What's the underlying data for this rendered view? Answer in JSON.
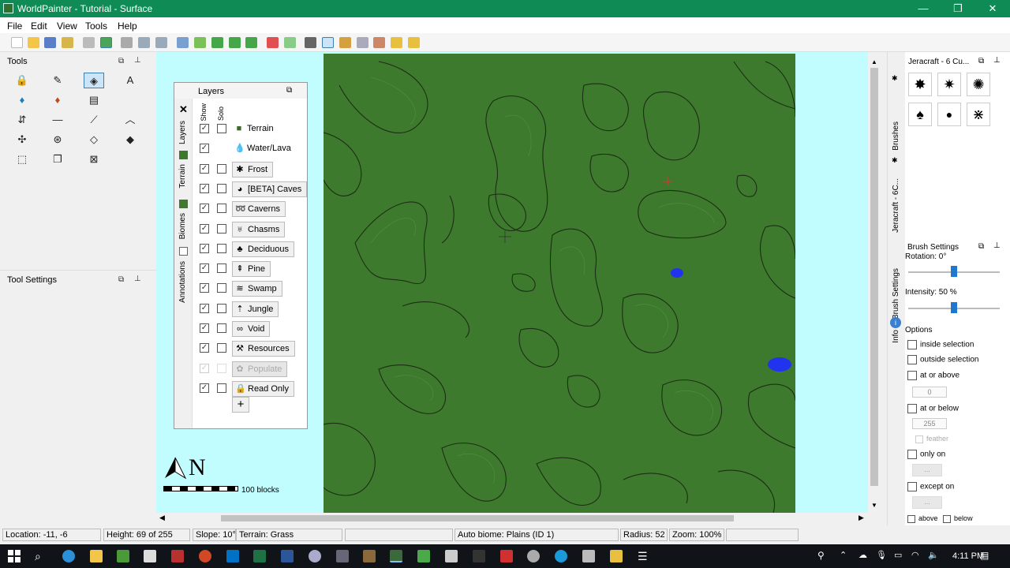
{
  "window": {
    "title": "WorldPainter - Tutorial - Surface",
    "min": "—",
    "max": "❐",
    "close": "✕"
  },
  "menu": [
    "File",
    "Edit",
    "View",
    "Tools",
    "Help"
  ],
  "tools_panel": {
    "title": "Tools"
  },
  "tool_settings_panel": {
    "title": "Tool Settings"
  },
  "layers_panel": {
    "title": "Layers",
    "col_show": "Show",
    "col_solo": "Solo",
    "side_tabs": [
      "Layers",
      "Terrain",
      "Biomes",
      "Annotations"
    ],
    "layers": [
      {
        "name": "Terrain",
        "icon": "terrain-cube-icon",
        "glyph": "■",
        "show": true,
        "solo": false,
        "has_solo": true,
        "button": false,
        "disabled": false
      },
      {
        "name": "Water/Lava",
        "icon": "water-drop-icon",
        "glyph": "💧",
        "show": true,
        "solo": false,
        "has_solo": false,
        "button": false,
        "disabled": false
      },
      {
        "name": "Frost",
        "icon": "frost-icon",
        "glyph": "✱",
        "show": true,
        "solo": false,
        "has_solo": true,
        "button": true,
        "disabled": false
      },
      {
        "name": "[BETA] Caves",
        "icon": "caves-icon",
        "glyph": "◕",
        "show": true,
        "solo": false,
        "has_solo": true,
        "button": true,
        "disabled": false
      },
      {
        "name": "Caverns",
        "icon": "caverns-icon",
        "glyph": "➿",
        "show": true,
        "solo": false,
        "has_solo": true,
        "button": true,
        "disabled": false
      },
      {
        "name": "Chasms",
        "icon": "chasms-icon",
        "glyph": "♅",
        "show": true,
        "solo": false,
        "has_solo": true,
        "button": true,
        "disabled": false
      },
      {
        "name": "Deciduous",
        "icon": "deciduous-tree-icon",
        "glyph": "♣",
        "show": true,
        "solo": false,
        "has_solo": true,
        "button": true,
        "disabled": false
      },
      {
        "name": "Pine",
        "icon": "pine-tree-icon",
        "glyph": "⇞",
        "show": true,
        "solo": false,
        "has_solo": true,
        "button": true,
        "disabled": false
      },
      {
        "name": "Swamp",
        "icon": "swamp-icon",
        "glyph": "≋",
        "show": true,
        "solo": false,
        "has_solo": true,
        "button": true,
        "disabled": false
      },
      {
        "name": "Jungle",
        "icon": "jungle-tree-icon",
        "glyph": "⇡",
        "show": true,
        "solo": false,
        "has_solo": true,
        "button": true,
        "disabled": false
      },
      {
        "name": "Void",
        "icon": "void-icon",
        "glyph": "∞",
        "show": true,
        "solo": false,
        "has_solo": true,
        "button": true,
        "disabled": false
      },
      {
        "name": "Resources",
        "icon": "resources-icon",
        "glyph": "⚒",
        "show": true,
        "solo": false,
        "has_solo": true,
        "button": true,
        "disabled": false
      },
      {
        "name": "Populate",
        "icon": "populate-icon",
        "glyph": "✿",
        "show": true,
        "solo": false,
        "has_solo": true,
        "button": true,
        "disabled": true
      },
      {
        "name": "Read Only",
        "icon": "lock-icon",
        "glyph": "🔒",
        "show": true,
        "solo": false,
        "has_solo": true,
        "button": true,
        "disabled": false
      }
    ],
    "add_button": "+"
  },
  "compass": {
    "letter": "N",
    "scale_label": "100 blocks"
  },
  "brushes_panel": {
    "title": "Jeracraft - 6 Cu...",
    "side_tabs": [
      "Brushes",
      "Jeracraft - 6C..."
    ]
  },
  "brush_settings": {
    "title": "Brush Settings",
    "rotation_label": "Rotation: 0°",
    "rotation_value": 0.5,
    "intensity_label": "Intensity: 50 %",
    "intensity_value": 0.5,
    "side_tabs": [
      "Brush Settings",
      "Info"
    ],
    "options_label": "Options",
    "options": {
      "inside_selection": "inside selection",
      "outside_selection": "outside selection",
      "at_or_above": "at or above",
      "at_or_above_value": "0",
      "at_or_below": "at or below",
      "at_or_below_value": "255",
      "feather": "feather",
      "only_on": "only on",
      "only_on_btn": "...",
      "except_on": "except on",
      "except_on_btn": "...",
      "above": "above",
      "below": "below"
    }
  },
  "status": {
    "location": "Location: -11, -6",
    "height": "Height: 69 of 255",
    "slope": "Slope: 10°",
    "terrain": "Terrain: Grass",
    "biome": "Auto biome: Plains (ID 1)",
    "radius": "Radius: 52",
    "zoom": "Zoom: 100%"
  },
  "taskbar": {
    "time": "4:11 PM"
  },
  "colors": {
    "titlebar": "#0f8c55",
    "map_green": "#3e7a2e",
    "viewport_bg": "#c1fcff",
    "water": "#2233ee"
  }
}
